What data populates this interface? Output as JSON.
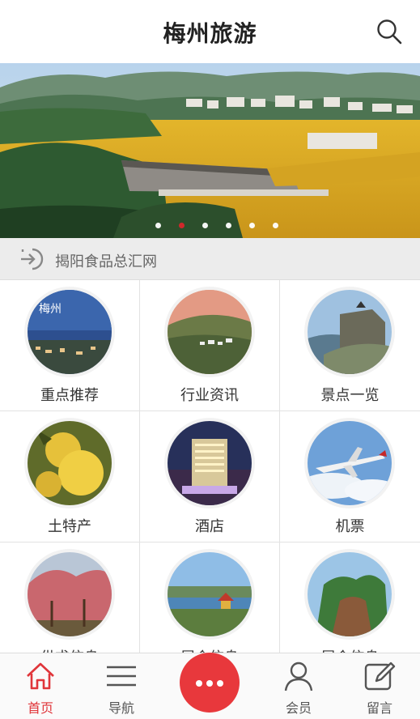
{
  "header": {
    "title": "梅州旅游",
    "search_icon": "search-icon"
  },
  "banner": {
    "slide_count": 6,
    "active_index": 1
  },
  "notice": {
    "icon": "login-arrow-icon",
    "text": "揭阳食品总汇网"
  },
  "grid": {
    "items": [
      {
        "label": "重点推荐",
        "image": "meizhou-city-aerial"
      },
      {
        "label": "行业资讯",
        "image": "sunset-town-valley"
      },
      {
        "label": "景点一览",
        "image": "rock-cliff-pavilion"
      },
      {
        "label": "土特产",
        "image": "pomelo-fruits"
      },
      {
        "label": "酒店",
        "image": "hotel-tower-night"
      },
      {
        "label": "机票",
        "image": "airplane-clouds"
      },
      {
        "label": "供求信息",
        "image": "plum-blossom-trees"
      },
      {
        "label": "展会信息",
        "image": "lakeside-pagoda"
      },
      {
        "label": "展会信息",
        "image": "green-mountain-peak"
      }
    ]
  },
  "tabbar": {
    "items": [
      {
        "label": "首页",
        "icon": "home-icon",
        "active": true
      },
      {
        "label": "导航",
        "icon": "menu-icon",
        "active": false
      },
      {
        "label": "",
        "icon": "more-dots-icon",
        "active": false
      },
      {
        "label": "会员",
        "icon": "user-icon",
        "active": false
      },
      {
        "label": "留言",
        "icon": "edit-icon",
        "active": false
      }
    ]
  },
  "colors": {
    "accent": "#e8383c",
    "active_text": "#e0353a",
    "notice_bg": "#ececec"
  }
}
